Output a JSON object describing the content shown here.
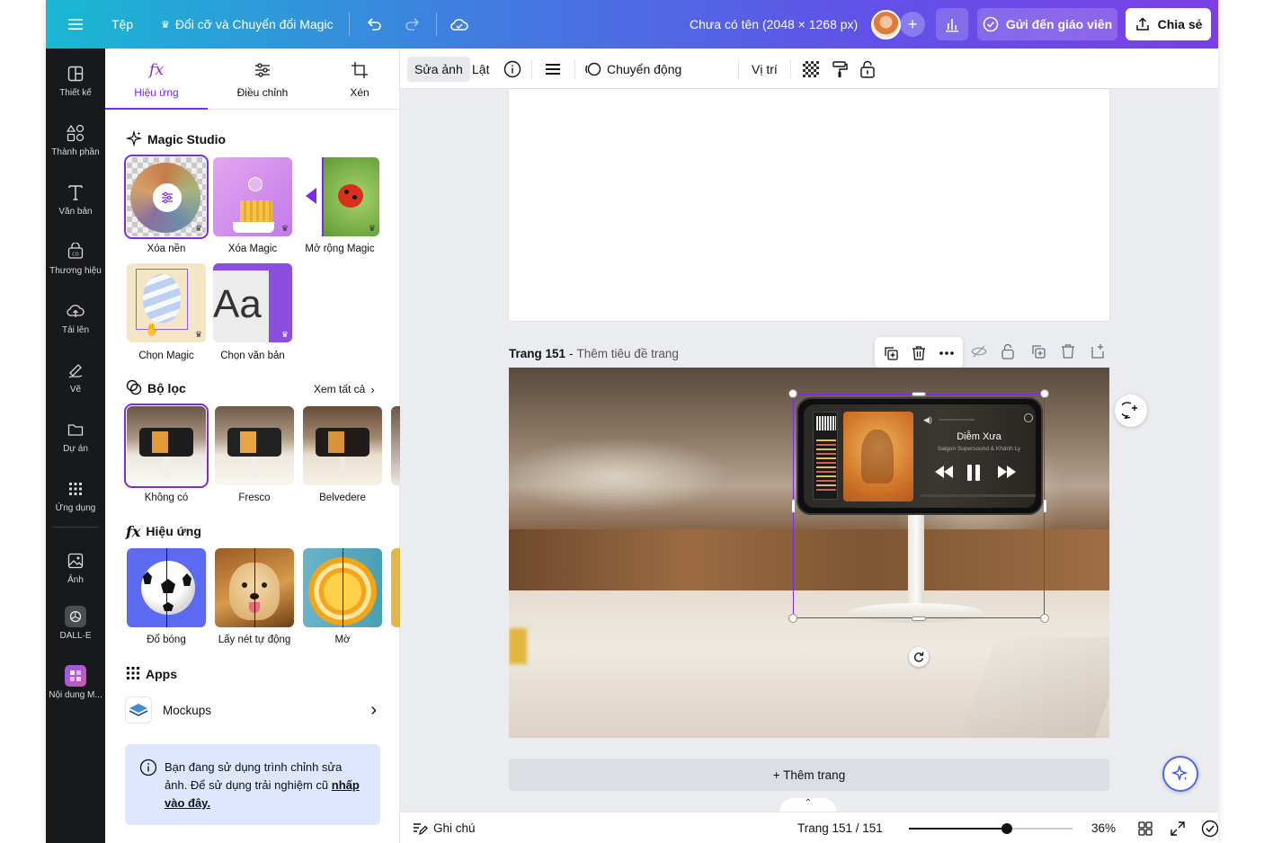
{
  "topbar": {
    "file_label": "Tệp",
    "magic_label": "Đổi cỡ và Chuyển đổi Magic",
    "doc_title": "Chưa có tên (2048 × 1268 px)",
    "send_teacher_label": "Gửi đến giáo viên",
    "share_label": "Chia sẻ"
  },
  "rail": {
    "items": [
      {
        "label": "Thiết kế"
      },
      {
        "label": "Thành phần"
      },
      {
        "label": "Văn bản"
      },
      {
        "label": "Thương hiệu"
      },
      {
        "label": "Tải lên"
      },
      {
        "label": "Vẽ"
      },
      {
        "label": "Dự án"
      },
      {
        "label": "Ứng dụng"
      },
      {
        "label": "Ảnh"
      },
      {
        "label": "DALL·E"
      },
      {
        "label": "Nội dung M..."
      }
    ]
  },
  "panel": {
    "tabs": [
      {
        "label": "Hiệu ứng"
      },
      {
        "label": "Điều chỉnh"
      },
      {
        "label": "Xén"
      }
    ],
    "magic_studio": {
      "title": "Magic Studio",
      "tools": [
        {
          "label": "Xóa nền"
        },
        {
          "label": "Xóa Magic"
        },
        {
          "label": "Mở rộng Magic"
        },
        {
          "label": "Chọn Magic"
        },
        {
          "label": "Chọn văn bản"
        }
      ],
      "text_sample": "Aa"
    },
    "filters": {
      "title": "Bộ lọc",
      "see_all": "Xem tất cả",
      "items": [
        {
          "label": "Không có"
        },
        {
          "label": "Fresco"
        },
        {
          "label": "Belvedere"
        }
      ]
    },
    "effects": {
      "title": "Hiệu ứng",
      "items": [
        {
          "label": "Đổ bóng"
        },
        {
          "label": "Lấy nét tự động"
        },
        {
          "label": "Mờ"
        }
      ]
    },
    "apps": {
      "title": "Apps",
      "mockups_label": "Mockups"
    },
    "info": {
      "text": "Bạn đang sử dụng trình chỉnh sửa ảnh. Để sử dụng trải nghiệm cũ ",
      "link": "nhấp vào đây."
    }
  },
  "ctxbar": {
    "edit_photo": "Sửa ảnh",
    "flip": "Lật",
    "animate": "Chuyển động",
    "position": "Vị trí"
  },
  "canvas": {
    "page_label": "Trang 151",
    "page_title_placeholder": "Thêm tiêu đề trang",
    "add_page": "+ Thêm trang",
    "player": {
      "song_title": "Diễm Xưa",
      "artist": "Saigon Supersound & Khánh Ly"
    }
  },
  "bottombar": {
    "notes": "Ghi chú",
    "page_counter": "Trang 151 / 151",
    "zoom": "36%",
    "zoom_fraction": 0.36
  },
  "colors": {
    "accent": "#7d2ae8",
    "rail_bg": "#18191b",
    "info_bg": "#dfe6ff"
  }
}
